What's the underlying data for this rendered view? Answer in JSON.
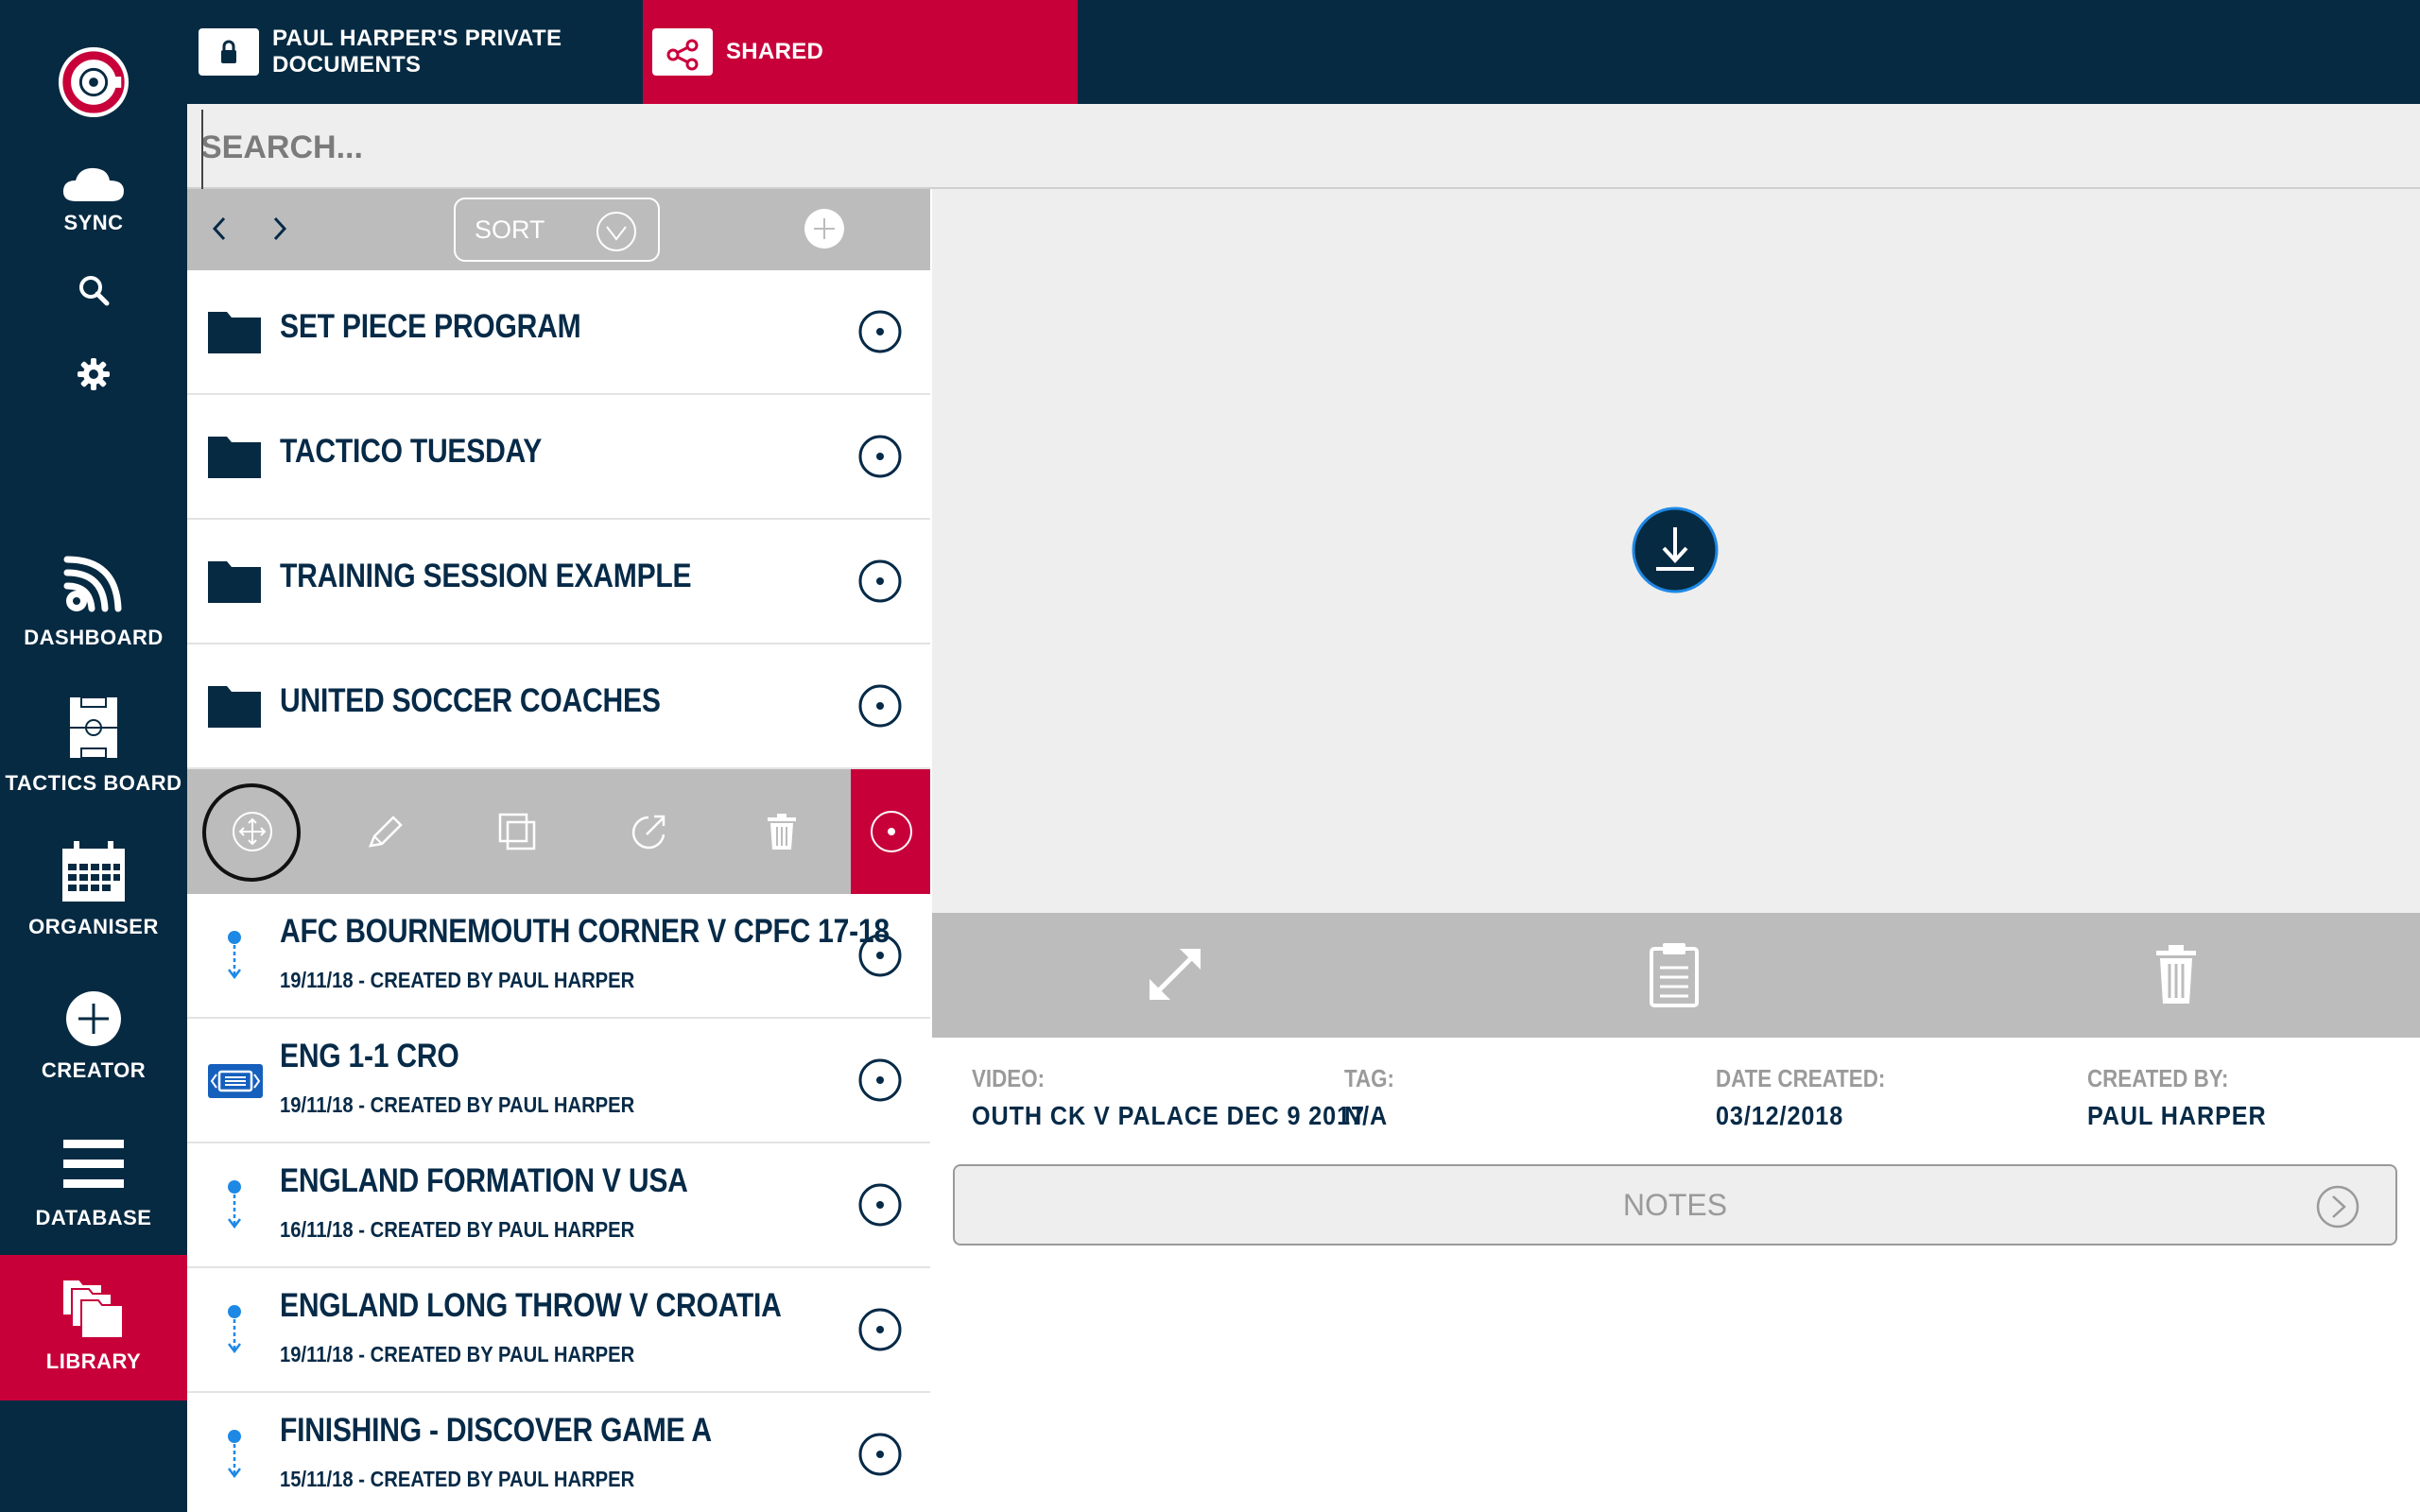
{
  "colors": {
    "navy": "#062a42",
    "red": "#c8003a",
    "grey": "#bcbcbc",
    "light": "#eeeeee",
    "blue": "#1e88e5"
  },
  "sidebar": {
    "items": [
      {
        "label": "SYNC",
        "icon": "cloud-icon"
      },
      {
        "label": "",
        "icon": "search-icon"
      },
      {
        "label": "",
        "icon": "gear-icon"
      },
      {
        "label": "DASHBOARD",
        "icon": "dashboard-icon"
      },
      {
        "label": "TACTICS BOARD",
        "icon": "pitch-icon"
      },
      {
        "label": "ORGANISER",
        "icon": "calendar-icon"
      },
      {
        "label": "CREATOR",
        "icon": "plus-circle-icon"
      },
      {
        "label": "DATABASE",
        "icon": "menu-icon"
      },
      {
        "label": "LIBRARY",
        "icon": "library-icon",
        "active": true
      }
    ]
  },
  "tabs": [
    {
      "label": "PAUL HARPER'S PRIVATE DOCUMENTS",
      "icon": "lock-folder-icon"
    },
    {
      "label": "SHARED",
      "icon": "share-folder-icon",
      "active": true
    }
  ],
  "search": {
    "placeholder": "SEARCH..."
  },
  "list": {
    "sort_label": "SORT",
    "folders": [
      {
        "name": "SET PIECE PROGRAM"
      },
      {
        "name": "TACTICO TUESDAY"
      },
      {
        "name": "TRAINING SESSION EXAMPLE"
      },
      {
        "name": "UNITED SOCCER COACHES"
      }
    ],
    "files": [
      {
        "name": "AFC BOURNEMOUTH CORNER V CPFC 17-18",
        "sub": "19/11/18 - CREATED BY PAUL HARPER",
        "icon": "animation-icon"
      },
      {
        "name": "ENG 1-1 CRO",
        "sub": "19/11/18 - CREATED BY PAUL HARPER",
        "icon": "video-icon"
      },
      {
        "name": "ENGLAND FORMATION V USA",
        "sub": "16/11/18 - CREATED BY PAUL HARPER",
        "icon": "animation-icon"
      },
      {
        "name": "ENGLAND LONG THROW V CROATIA",
        "sub": "19/11/18 - CREATED BY PAUL HARPER",
        "icon": "animation-icon"
      },
      {
        "name": "FINISHING - DISCOVER GAME A",
        "sub": "15/11/18 - CREATED BY PAUL HARPER",
        "icon": "animation-icon"
      }
    ]
  },
  "details": {
    "video_label": "VIDEO:",
    "video_value": "OUTH CK V PALACE DEC 9 2017",
    "tag_label": "TAG:",
    "tag_value": "N/A",
    "date_label": "DATE CREATED:",
    "date_value": "03/12/2018",
    "creator_label": "CREATED BY:",
    "creator_value": "PAUL HARPER",
    "notes_label": "NOTES"
  }
}
